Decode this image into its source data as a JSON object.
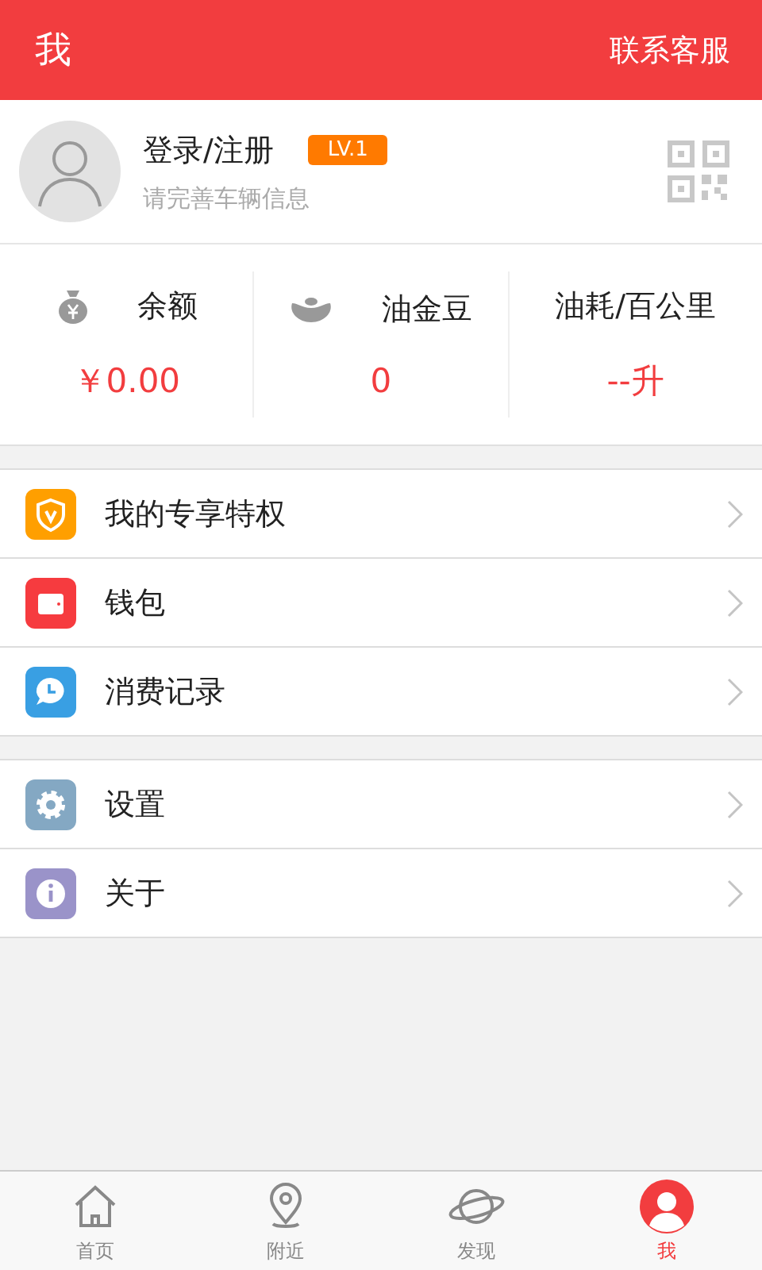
{
  "header": {
    "title": "我",
    "action": "联系客服"
  },
  "profile": {
    "name": "登录/注册",
    "level_badge": "LV.1",
    "hint": "请完善车辆信息"
  },
  "stats": [
    {
      "kind": "moneybag",
      "label": "余额",
      "value": "￥0.00"
    },
    {
      "kind": "bean",
      "label": "油金豆",
      "value": "0"
    },
    {
      "kind": "none",
      "label": "油耗/百公里",
      "value": "--升"
    }
  ],
  "menu_groups": [
    [
      {
        "kind": "shield",
        "label": "我的专享特权",
        "color": "#ff9f00"
      },
      {
        "kind": "wallet",
        "label": "钱包",
        "color": "#f63b3f"
      },
      {
        "kind": "chat",
        "label": "消费记录",
        "color": "#399fe3"
      }
    ],
    [
      {
        "kind": "gear",
        "label": "设置",
        "color": "#84a8c3"
      },
      {
        "kind": "info",
        "label": "关于",
        "color": "#9a93c9"
      }
    ]
  ],
  "tabs": [
    {
      "kind": "home",
      "label": "首页",
      "selected": false
    },
    {
      "kind": "pin",
      "label": "附近",
      "selected": false
    },
    {
      "kind": "planet",
      "label": "发现",
      "selected": false
    },
    {
      "kind": "person",
      "label": "我",
      "selected": true
    }
  ]
}
